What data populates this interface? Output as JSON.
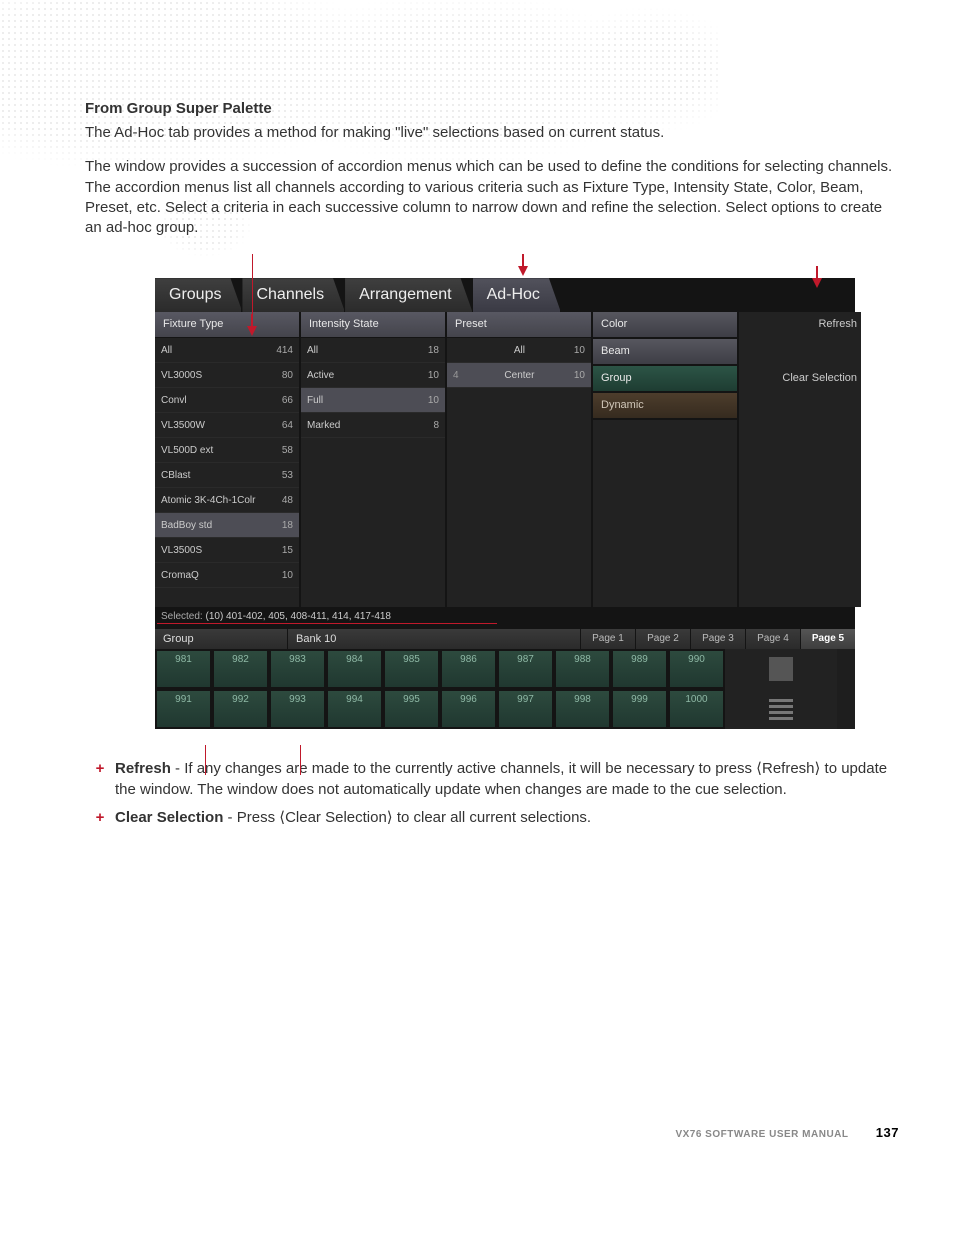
{
  "heading": "From Group Super Palette",
  "para1": "The Ad-Hoc tab provides a method for making \"live\" selections based on current status.",
  "para2": "The window provides a succession of accordion menus which can be used to define the conditions for selecting channels. The accordion menus list all channels according to various criteria such as Fixture Type, Intensity State, Color, Beam, Preset, etc. Select a criteria in each successive column to narrow down and refine the selection. Select options to create an ad-hoc group.",
  "tabs": [
    "Groups",
    "Channels",
    "Arrangement",
    "Ad-Hoc"
  ],
  "active_tab": "Ad-Hoc",
  "columns": {
    "fixture": {
      "title": "Fixture Type",
      "rows": [
        {
          "label": "All",
          "n": "414"
        },
        {
          "label": "VL3000S",
          "n": "80"
        },
        {
          "label": "Convl",
          "n": "66"
        },
        {
          "label": "VL3500W",
          "n": "64"
        },
        {
          "label": "VL500D ext",
          "n": "58"
        },
        {
          "label": "CBlast",
          "n": "53"
        },
        {
          "label": "Atomic 3K-4Ch-1Colr",
          "n": "48"
        },
        {
          "label": "BadBoy std",
          "n": "18",
          "sel": true
        },
        {
          "label": "VL3500S",
          "n": "15"
        },
        {
          "label": "CromaQ",
          "n": "10"
        }
      ]
    },
    "intensity": {
      "title": "Intensity State",
      "rows": [
        {
          "label": "All",
          "n": "18"
        },
        {
          "label": "Active",
          "n": "10"
        },
        {
          "label": "Full",
          "n": "10",
          "sel": true
        },
        {
          "label": "Marked",
          "n": "8"
        }
      ]
    },
    "preset": {
      "title": "Preset",
      "rows": [
        {
          "pre": "",
          "label": "All",
          "n": "10"
        },
        {
          "pre": "4",
          "label": "Center",
          "n": "10",
          "sel": true
        }
      ]
    },
    "categories": [
      "Color",
      "Beam",
      "Group",
      "Dynamic"
    ]
  },
  "side": {
    "refresh": "Refresh",
    "clear": "Clear Selection"
  },
  "selected": {
    "label": "Selected:",
    "value": "(10) 401-402, 405, 408-411, 414, 417-418"
  },
  "bank": {
    "group": "Group",
    "bank": "Bank 10",
    "pages": [
      "Page 1",
      "Page 2",
      "Page 3",
      "Page 4",
      "Page 5"
    ],
    "active_page": "Page 5",
    "row1": [
      "981",
      "982",
      "983",
      "984",
      "985",
      "986",
      "987",
      "988",
      "989",
      "990"
    ],
    "row2": [
      "991",
      "992",
      "993",
      "994",
      "995",
      "996",
      "997",
      "998",
      "999",
      "1000"
    ]
  },
  "bullets": [
    {
      "bold": "Refresh",
      "text": " - If any changes are made to the currently active channels, it will be necessary to press ⟨Refresh⟩ to update the window. The window does not automatically update when changes are made to the cue selection."
    },
    {
      "bold": "Clear Selection",
      "text": " - Press ⟨Clear Selection⟩ to clear all current selections."
    }
  ],
  "footer": {
    "title": "VX76 SOFTWARE USER MANUAL",
    "page": "137"
  }
}
